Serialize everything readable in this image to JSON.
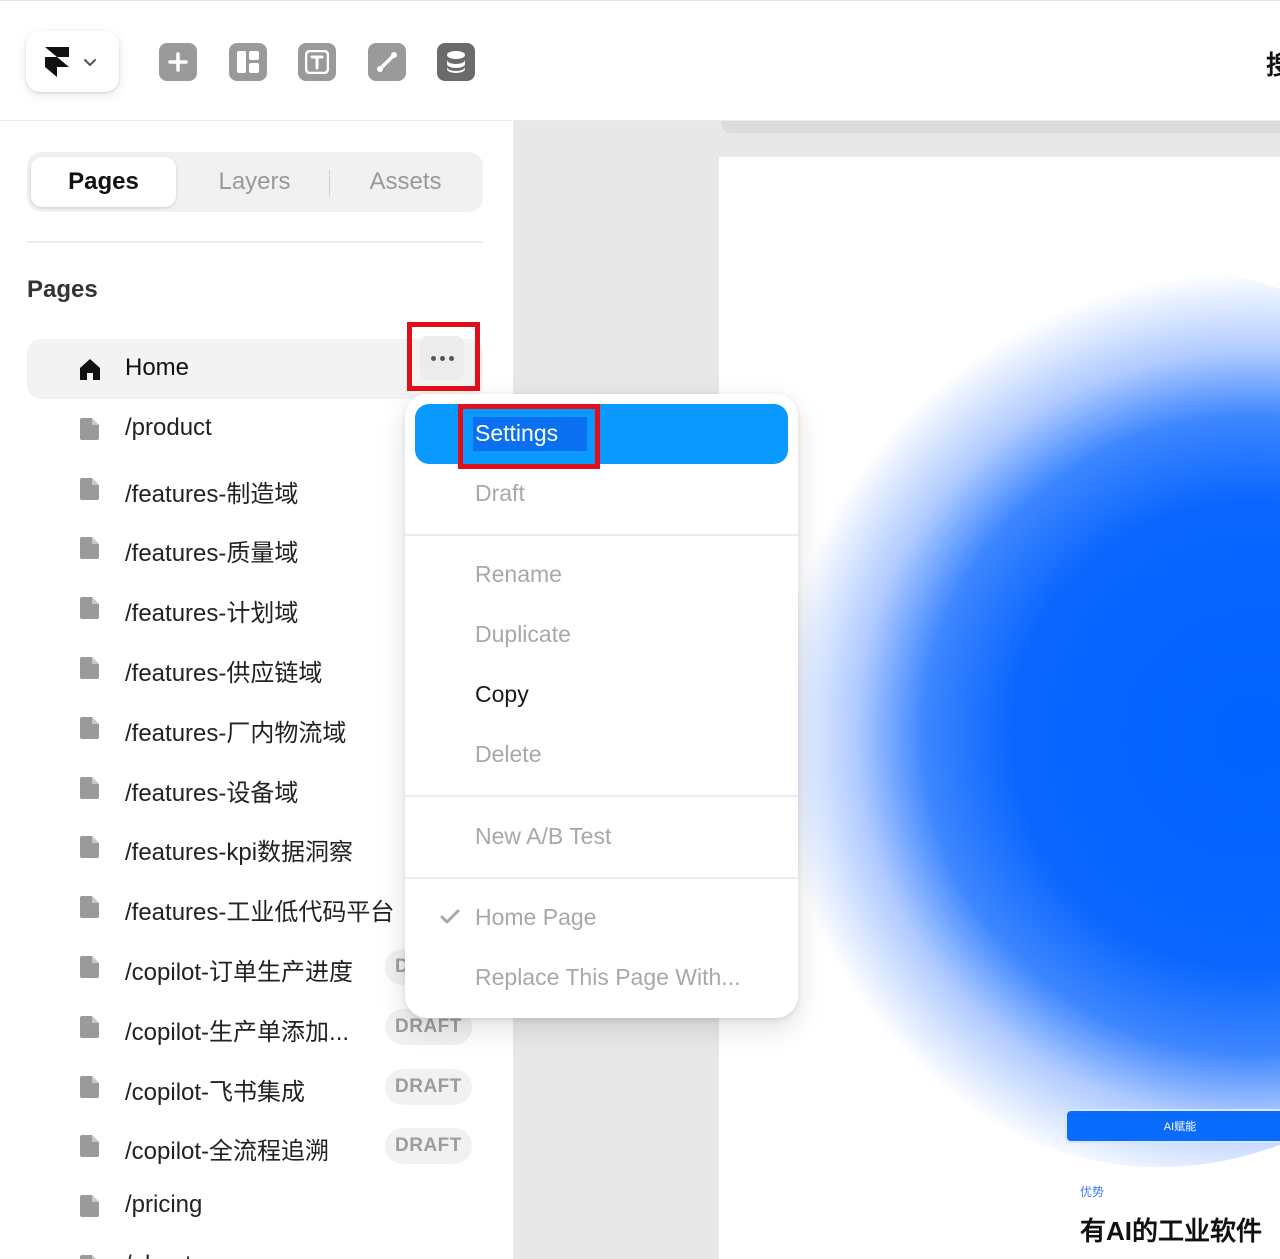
{
  "toolbar": {
    "tools": [
      "insert-icon",
      "layout-icon",
      "text-icon",
      "link-icon",
      "database-icon"
    ],
    "cut_text": "搜"
  },
  "sidebar": {
    "tabs": [
      {
        "label": "Pages",
        "active": true
      },
      {
        "label": "Layers",
        "active": false
      },
      {
        "label": "Assets",
        "active": false
      }
    ],
    "section_title": "Pages",
    "pages": [
      {
        "label": "Home",
        "icon": "home-icon",
        "selected": true,
        "badge": ""
      },
      {
        "label": "/product",
        "icon": "page-icon",
        "badge": ""
      },
      {
        "label": "/features-制造域",
        "icon": "page-icon",
        "badge": ""
      },
      {
        "label": "/features-质量域",
        "icon": "page-icon",
        "badge": ""
      },
      {
        "label": "/features-计划域",
        "icon": "page-icon",
        "badge": ""
      },
      {
        "label": "/features-供应链域",
        "icon": "page-icon",
        "badge": ""
      },
      {
        "label": "/features-厂内物流域",
        "icon": "page-icon",
        "badge": ""
      },
      {
        "label": "/features-设备域",
        "icon": "page-icon",
        "badge": ""
      },
      {
        "label": "/features-kpi数据洞察",
        "icon": "page-icon",
        "badge": ""
      },
      {
        "label": "/features-工业低代码平台",
        "icon": "page-icon",
        "badge": ""
      },
      {
        "label": "/copilot-订单生产进度",
        "icon": "page-icon",
        "badge": "D"
      },
      {
        "label": "/copilot-生产单添加...",
        "icon": "page-icon",
        "badge": "DRAFT"
      },
      {
        "label": "/copilot-飞书集成",
        "icon": "page-icon",
        "badge": "DRAFT"
      },
      {
        "label": "/copilot-全流程追溯",
        "icon": "page-icon",
        "badge": "DRAFT"
      },
      {
        "label": "/pricing",
        "icon": "page-icon",
        "badge": ""
      },
      {
        "label": "/about",
        "icon": "page-icon",
        "badge": ""
      }
    ]
  },
  "context_menu": {
    "items": [
      {
        "label": "Settings",
        "state": "highlighted"
      },
      {
        "label": "Draft",
        "state": "disabled"
      },
      {
        "label": "Rename",
        "state": "disabled"
      },
      {
        "label": "Duplicate",
        "state": "disabled"
      },
      {
        "label": "Copy",
        "state": "enabled"
      },
      {
        "label": "Delete",
        "state": "disabled"
      },
      {
        "label": "New A/B Test",
        "state": "disabled"
      },
      {
        "label": "Home Page",
        "state": "checked"
      },
      {
        "label": "Replace This Page With...",
        "state": "disabled"
      }
    ]
  },
  "canvas": {
    "badge": "AI赋能",
    "kicker": "优势",
    "headline": "有AI的工业软件"
  },
  "colors": {
    "highlight": "#0a99ff",
    "annotation_red": "#e0101a",
    "glow_blue": "#0062ff"
  }
}
